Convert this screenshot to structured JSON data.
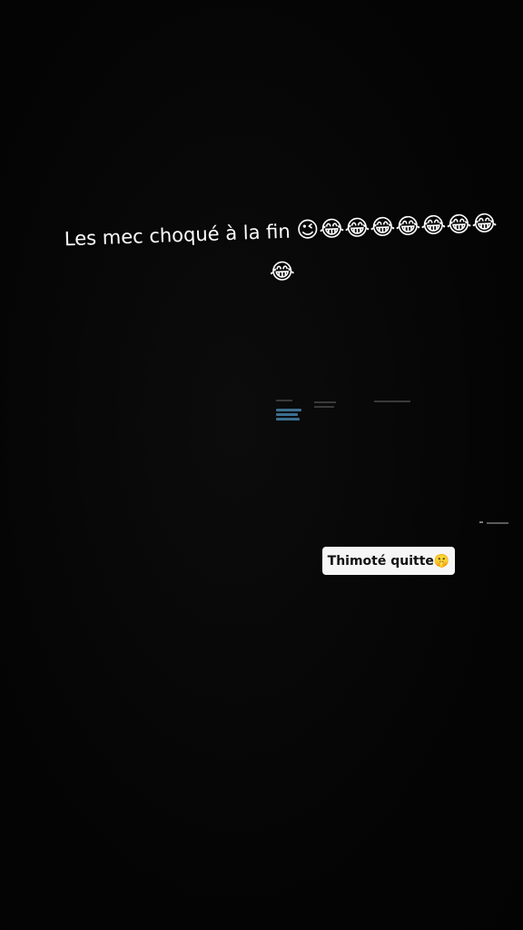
{
  "caption": {
    "text": "Les mec choqué à la fin",
    "emojis": "😉😂😂😂😂😂😂😂😂"
  },
  "sticker": {
    "text": "Thimoté quitte🤫"
  },
  "colors": {
    "background": "#050505",
    "caption_text": "#ffffff",
    "sticker_bg": "#f6f6f6",
    "sticker_text": "#111111"
  }
}
